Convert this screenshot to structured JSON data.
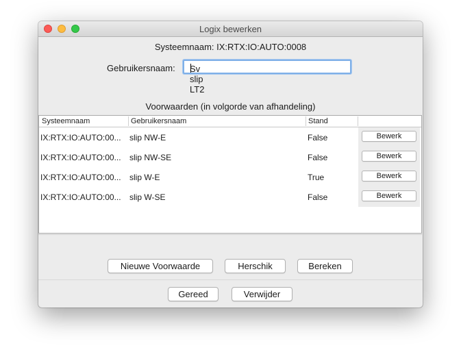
{
  "window": {
    "title": "Logix bewerken"
  },
  "header": {
    "system_name": "Systeemnaam: IX:RTX:IO:AUTO:0008",
    "username_label": "Gebruikersnaam:",
    "username_value": "Sv slip LT2"
  },
  "conditions": {
    "title": "Voorwaarden (in volgorde van afhandeling)",
    "columns": [
      "Systeemnaam",
      "Gebruikersnaam",
      "Stand",
      ""
    ],
    "rows": [
      {
        "system": "IX:RTX:IO:AUTO:00...",
        "user": "slip NW-E",
        "state": "False",
        "action": "Bewerk"
      },
      {
        "system": "IX:RTX:IO:AUTO:00...",
        "user": "slip NW-SE",
        "state": "False",
        "action": "Bewerk"
      },
      {
        "system": "IX:RTX:IO:AUTO:00...",
        "user": "slip W-E",
        "state": "True",
        "action": "Bewerk"
      },
      {
        "system": "IX:RTX:IO:AUTO:00...",
        "user": "slip W-SE",
        "state": "False",
        "action": "Bewerk"
      }
    ]
  },
  "actions": {
    "new_condition": "Nieuwe Voorwaarde",
    "reorder": "Herschik",
    "calculate": "Bereken",
    "done": "Gereed",
    "delete": "Verwijder"
  },
  "colors": {
    "close": "#fc5b57",
    "minimize": "#fdbc40",
    "maximize": "#34c84a",
    "focus_ring": "#7fb0e8"
  }
}
